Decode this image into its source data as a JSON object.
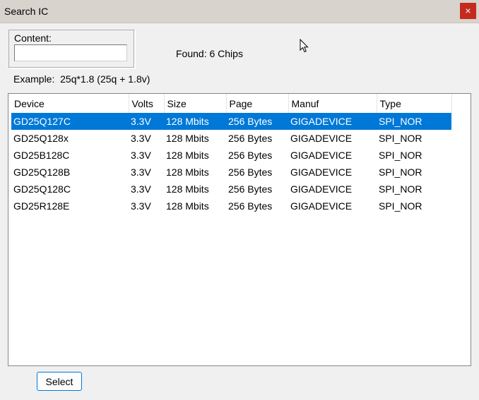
{
  "window": {
    "title": "Search IC",
    "close_symbol": "×"
  },
  "search": {
    "content_label": "Content:",
    "content_value": "",
    "found_text": "Found: 6 Chips",
    "example_text": "Example:  25q*1.8 (25q + 1.8v)"
  },
  "table": {
    "columns": [
      "Device",
      "Volts",
      "Size",
      "Page",
      "Manuf",
      "Type"
    ],
    "rows": [
      [
        "GD25Q127C",
        "3.3V",
        "128 Mbits",
        "256 Bytes",
        "GIGADEVICE",
        "SPI_NOR"
      ],
      [
        "GD25Q128x",
        "3.3V",
        "128 Mbits",
        "256 Bytes",
        "GIGADEVICE",
        "SPI_NOR"
      ],
      [
        "GD25B128C",
        "3.3V",
        "128 Mbits",
        "256 Bytes",
        "GIGADEVICE",
        "SPI_NOR"
      ],
      [
        "GD25Q128B",
        "3.3V",
        "128 Mbits",
        "256 Bytes",
        "GIGADEVICE",
        "SPI_NOR"
      ],
      [
        "GD25Q128C",
        "3.3V",
        "128 Mbits",
        "256 Bytes",
        "GIGADEVICE",
        "SPI_NOR"
      ],
      [
        "GD25R128E",
        "3.3V",
        "128 Mbits",
        "256 Bytes",
        "GIGADEVICE",
        "SPI_NOR"
      ]
    ],
    "selected_row": 0
  },
  "footer": {
    "select_label": "Select"
  },
  "colors": {
    "selection": "#0078d7",
    "close_button": "#c42b1c",
    "titlebar": "#d8d3cd"
  },
  "icons": {
    "cursor": "mouse-pointer-icon"
  }
}
